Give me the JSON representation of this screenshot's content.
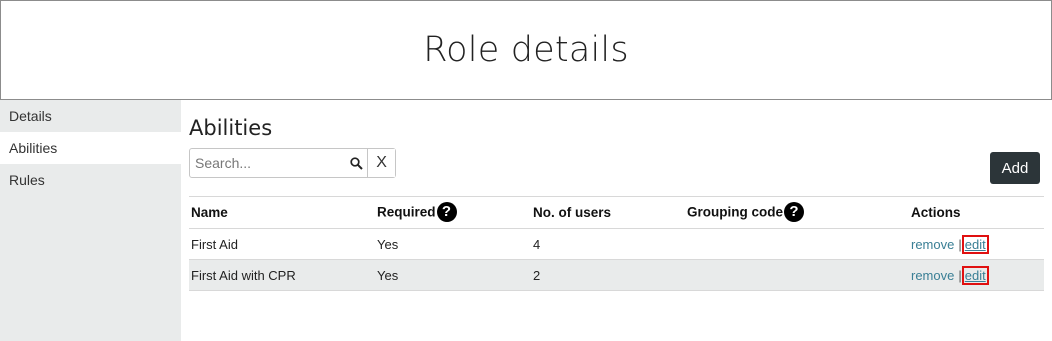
{
  "page": {
    "title": "Role details"
  },
  "sidebar": {
    "items": [
      {
        "label": "Details",
        "active": false
      },
      {
        "label": "Abilities",
        "active": true
      },
      {
        "label": "Rules",
        "active": false
      }
    ]
  },
  "section": {
    "title": "Abilities"
  },
  "search": {
    "placeholder": "Search...",
    "value": "",
    "clear_label": "X",
    "icon": "search-icon"
  },
  "toolbar": {
    "add_label": "Add"
  },
  "table": {
    "headers": {
      "name": "Name",
      "required": "Required",
      "users": "No. of users",
      "grouping": "Grouping code",
      "actions": "Actions",
      "help_glyph": "?"
    },
    "rows": [
      {
        "name": "First Aid",
        "required": "Yes",
        "users": "4",
        "grouping": "",
        "remove": "remove",
        "sep": "|",
        "edit": "edit"
      },
      {
        "name": "First Aid with CPR",
        "required": "Yes",
        "users": "2",
        "grouping": "",
        "remove": "remove",
        "sep": "|",
        "edit": "edit"
      }
    ]
  },
  "colors": {
    "add_button": "#2c3539",
    "link": "#3a7f95",
    "highlight": "#e01010",
    "sidebar_bg": "#e9ebeb"
  }
}
